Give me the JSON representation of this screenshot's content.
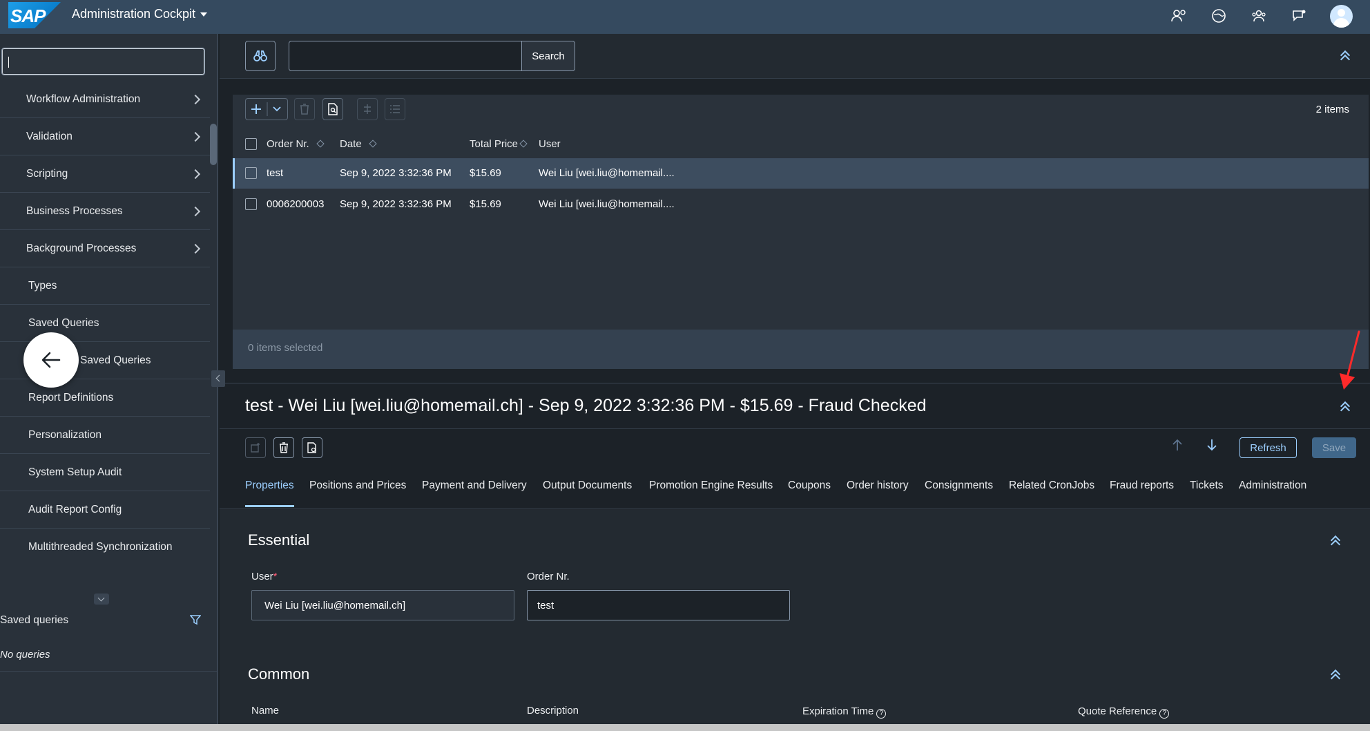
{
  "shell": {
    "logo_text": "SAP",
    "app_title": "Administration Cockpit"
  },
  "nav": {
    "items": [
      {
        "label": "Workflow Administration"
      },
      {
        "label": "Validation"
      },
      {
        "label": "Scripting"
      },
      {
        "label": "Business Processes"
      },
      {
        "label": "Background Processes"
      },
      {
        "label": "Types"
      },
      {
        "label": "Saved Queries"
      },
      {
        "label": "Saved Queries"
      },
      {
        "label": "Report Definitions"
      },
      {
        "label": "Personalization"
      },
      {
        "label": "System Setup Audit"
      },
      {
        "label": "Audit Report Config"
      },
      {
        "label": "Multithreaded Synchronization"
      }
    ],
    "saved_queries_title": "Saved queries",
    "no_queries": "No queries"
  },
  "search": {
    "button_label": "Search",
    "value": ""
  },
  "list": {
    "count": "2 items",
    "columns": [
      "Order Nr.",
      "Date",
      "Total Price",
      "User"
    ],
    "rows": [
      {
        "order": "test",
        "date": "Sep 9, 2022 3:32:36 PM",
        "price": "$15.69",
        "user": "Wei Liu [wei.liu@homemail...."
      },
      {
        "order": "0006200003",
        "date": "Sep 9, 2022 3:32:36 PM",
        "price": "$15.69",
        "user": "Wei Liu [wei.liu@homemail...."
      }
    ],
    "footer": "0 items selected"
  },
  "detail": {
    "title": "test - Wei Liu [wei.liu@homemail.ch] - Sep 9, 2022 3:32:36 PM - $15.69 - Fraud Checked",
    "refresh_label": "Refresh",
    "save_label": "Save",
    "tabs": [
      "Properties",
      "Positions and Prices",
      "Payment and Delivery",
      "Output Documents",
      "Promotion Engine Results",
      "Coupons",
      "Order history",
      "Consignments",
      "Related CronJobs",
      "Fraud reports",
      "Tickets",
      "Administration"
    ],
    "essential": {
      "title": "Essential",
      "user_label": "User",
      "user_required": "*",
      "user_value": "Wei Liu [wei.liu@homemail.ch]",
      "order_label": "Order Nr.",
      "order_value": "test"
    },
    "common": {
      "title": "Common",
      "name_label": "Name",
      "description_label": "Description",
      "expiration_label": "Expiration Time",
      "quote_label": "Quote Reference"
    }
  },
  "colors": {
    "shell": "#354a5f",
    "accent": "#9ccfff",
    "background": "#1c2228"
  }
}
